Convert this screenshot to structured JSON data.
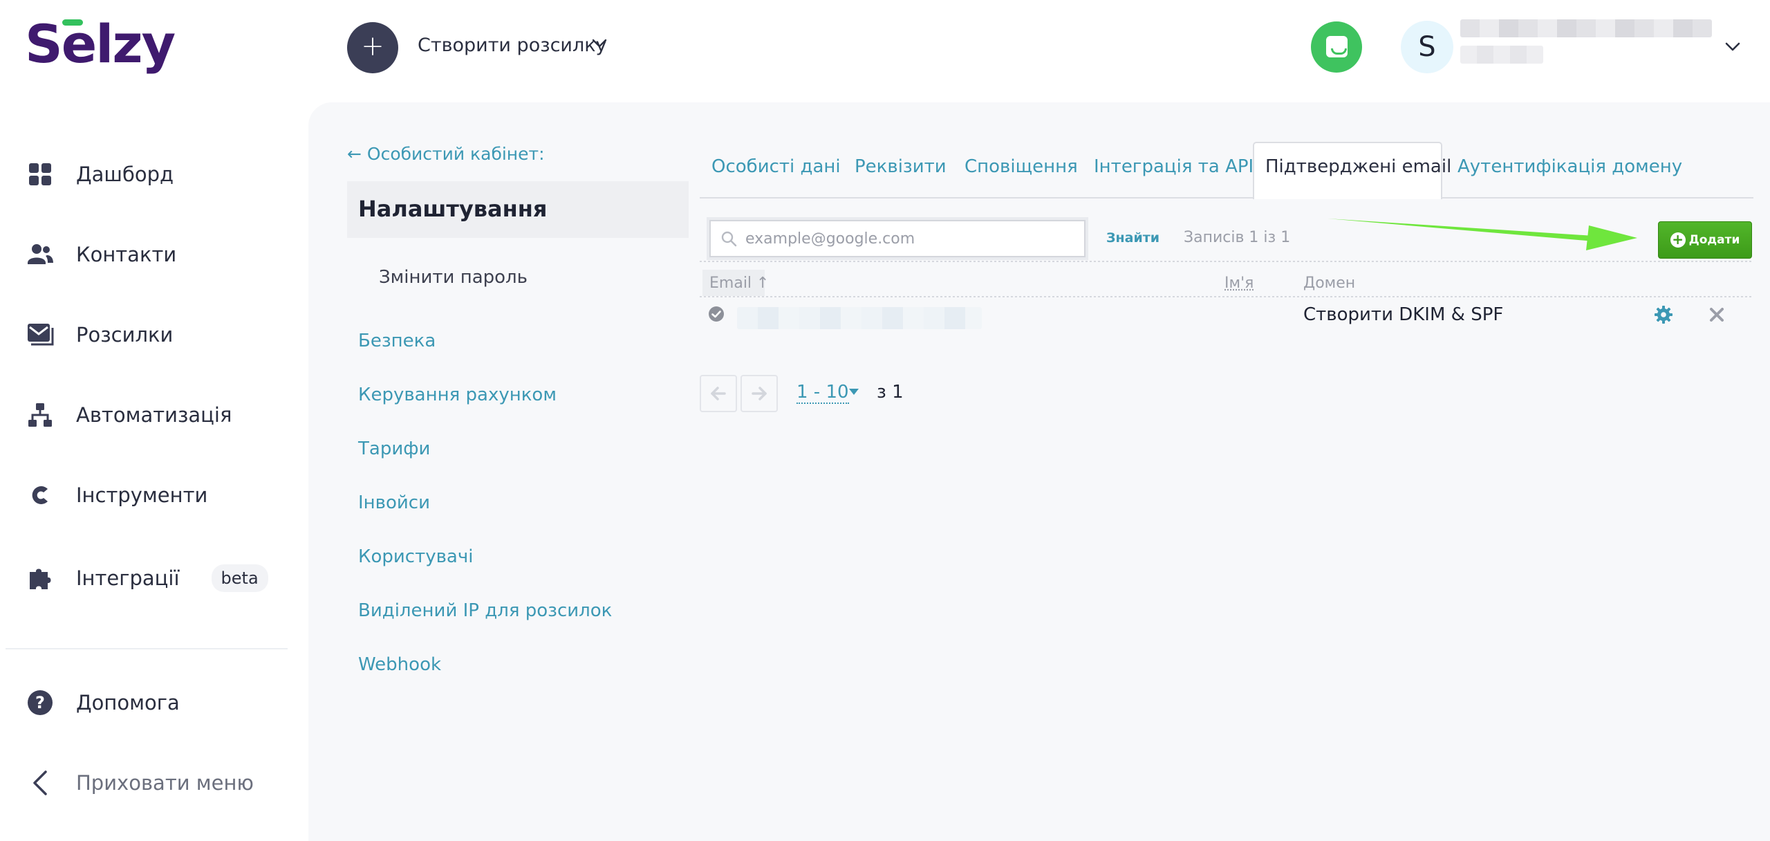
{
  "brand": {
    "logo_text": "Selzy"
  },
  "header": {
    "create_button_symbol": "+",
    "create_label": "Створити розсилку",
    "avatar_letter": "S"
  },
  "sidebar": {
    "items": [
      {
        "label": "Дашборд",
        "icon": "dashboard-icon"
      },
      {
        "label": "Контакти",
        "icon": "contacts-icon"
      },
      {
        "label": "Розсилки",
        "icon": "mail-icon"
      },
      {
        "label": "Автоматизація",
        "icon": "automation-icon"
      },
      {
        "label": "Інструменти",
        "icon": "tools-icon"
      },
      {
        "label": "Інтеграції",
        "icon": "puzzle-icon",
        "badge": "beta"
      }
    ],
    "help_label": "Допомога",
    "hide_menu_label": "Приховати меню"
  },
  "settings": {
    "back_link": "← Особистий кабінет:",
    "title": "Налаштування",
    "change_password": "Змінити пароль",
    "menu": [
      "Безпека",
      "Керування рахунком",
      "Тарифи",
      "Інвойси",
      "Користувачі",
      "Виділений IP для розсилок",
      "Webhook"
    ]
  },
  "tabs": [
    "Особисті дані",
    "Реквізити",
    "Сповіщення",
    "Інтеграція та API",
    "Підтверджені email",
    "Аутентифікація домену"
  ],
  "active_tab": "Підтверджені email",
  "search": {
    "placeholder": "example@google.com",
    "find_label": "Знайти",
    "records_label": "Записів 1 із 1"
  },
  "add_button": {
    "label": "Додати"
  },
  "table": {
    "headers": {
      "email": "Email ↑",
      "name": "Ім'я",
      "domain": "Домен"
    },
    "rows": [
      {
        "domain_action": "Створити DKIM & SPF"
      }
    ]
  },
  "pagination": {
    "range": "1 - 10",
    "of_label": "з 1"
  },
  "colors": {
    "accent": "#3c98b4",
    "brand_purple": "#3f1a6e",
    "brand_green": "#33c15d",
    "add_button": "#45a61f",
    "arrow": "#6fe63d"
  }
}
